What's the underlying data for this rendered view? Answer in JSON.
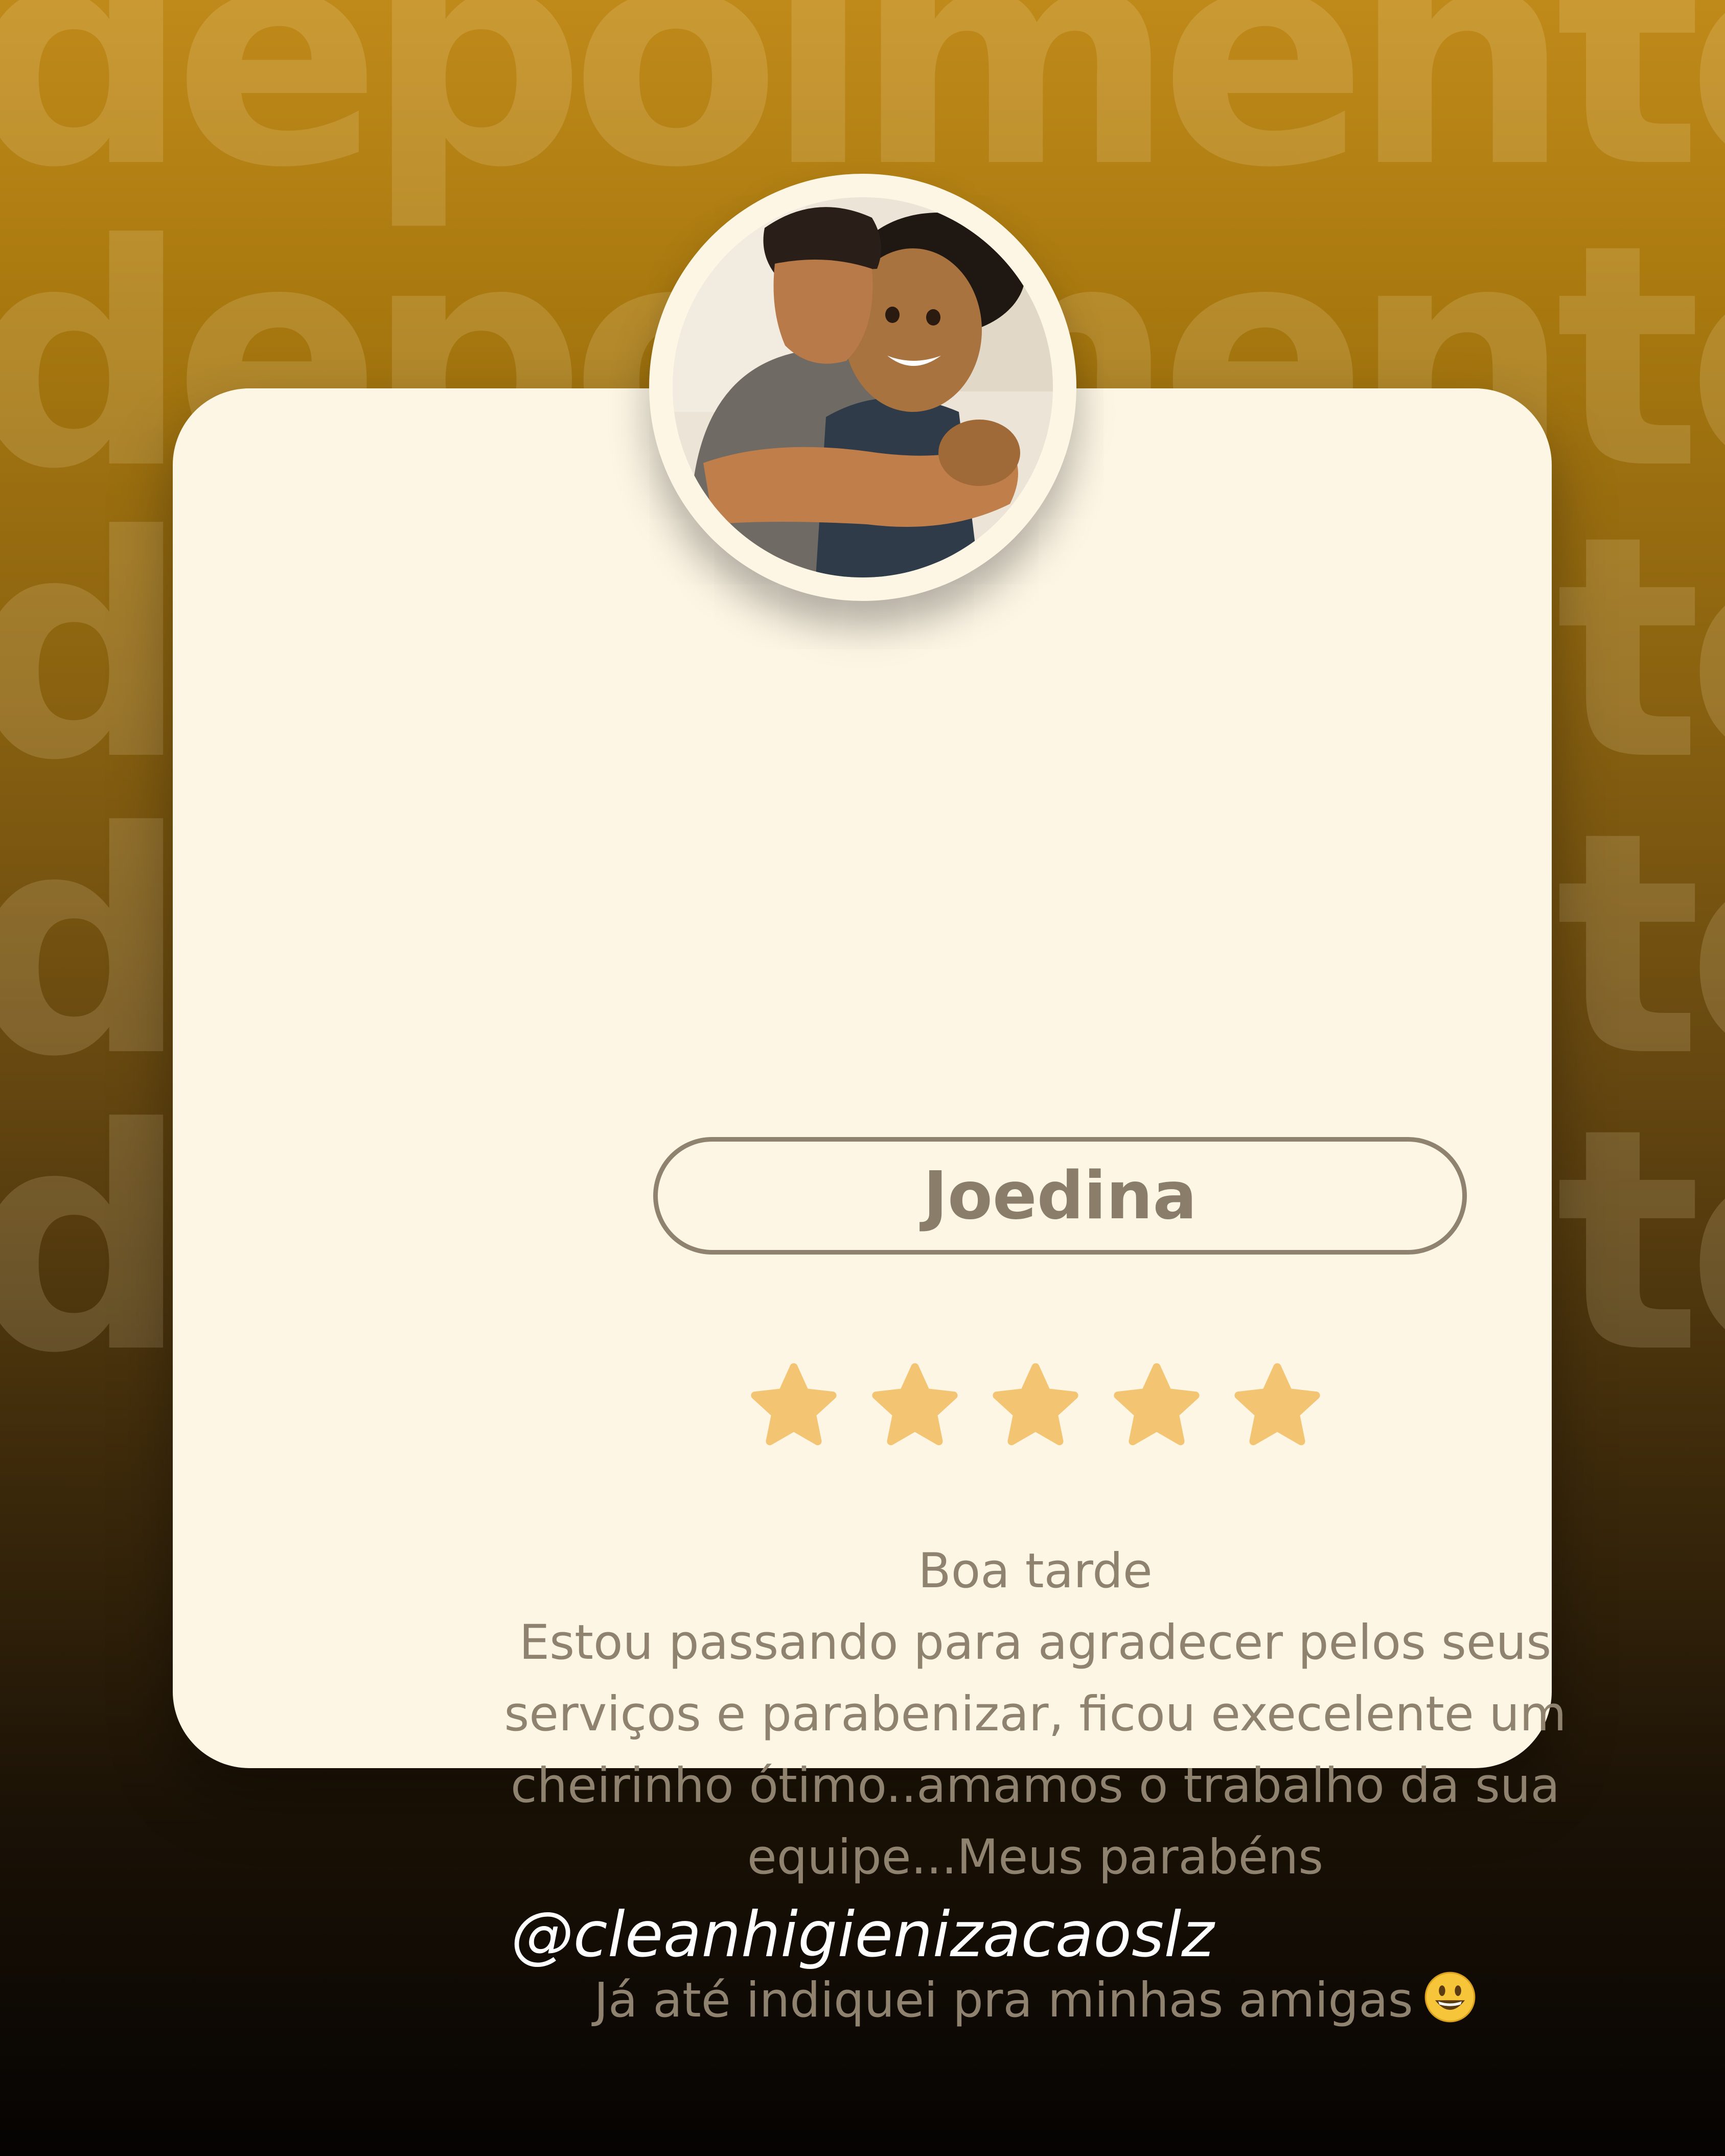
{
  "colors": {
    "background_top": "#c08a1a",
    "background_bottom": "#050302",
    "card": "#fdf6e5",
    "text": "#8f8370",
    "star": "#f3c472",
    "handle": "#ffffff"
  },
  "background_words": [
    "depoimento",
    "depoimento",
    "depoimento",
    "depoimento",
    "depoimento"
  ],
  "card": {
    "avatar_icon": "couple-photo",
    "name": "Joedina",
    "rating": 5,
    "rating_max": 5,
    "review_lines": [
      "Boa tarde",
      "Estou passando para agradecer pelos seus",
      "serviços e parabenizar, ficou execelente um",
      "cheirinho ótimo..amamos o trabalho da sua",
      "equipe...Meus parabéns"
    ],
    "review_footer": "Já até indiquei pra minhas amigas",
    "emoji_icon": "grinning-face-emoji"
  },
  "footer": {
    "handle": "@cleanhigienizacaoslz"
  }
}
